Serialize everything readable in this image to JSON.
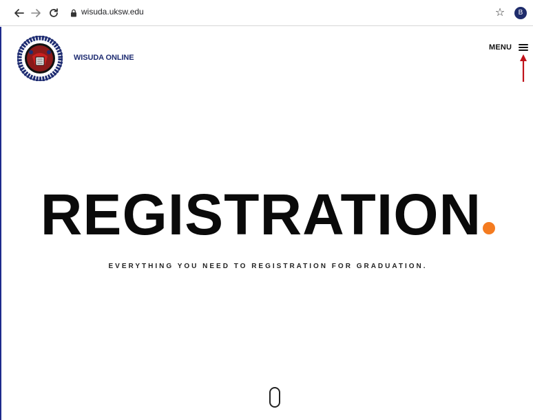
{
  "browser": {
    "url": "wisuda.uksw.edu",
    "profile_initial": "B"
  },
  "header": {
    "site_name": "WISUDA ONLINE",
    "menu_label": "MENU"
  },
  "hero": {
    "title": "REGISTRATION",
    "tagline": "EVERYTHING YOU NEED TO REGISTRATION FOR GRADUATION."
  },
  "colors": {
    "accent": "#f47b20",
    "brand": "#1f2d72",
    "arrow": "#c0121a"
  }
}
